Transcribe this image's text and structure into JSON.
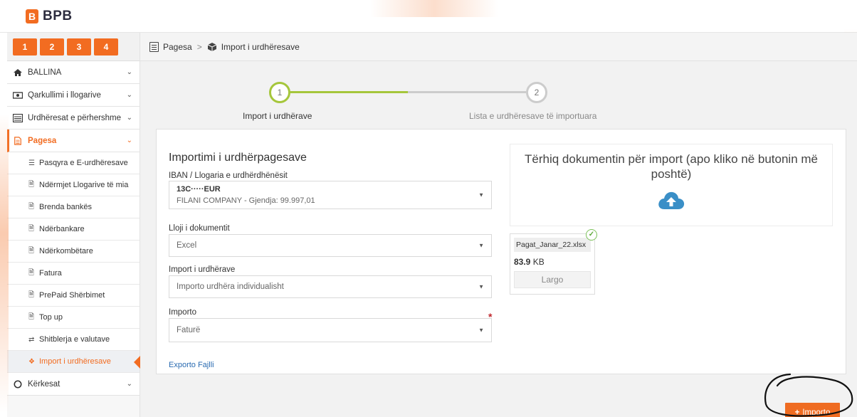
{
  "app": {
    "logo_text": "BPB",
    "logo_letter": "B"
  },
  "shortcuts": [
    "1",
    "2",
    "3",
    "4"
  ],
  "breadcrumb": {
    "parent": "Pagesa",
    "separator": ">",
    "current": "Import i urdhëresave"
  },
  "sidebar": {
    "items": [
      {
        "label": "BALLINA",
        "icon": "home-icon"
      },
      {
        "label": "Qarkullimi i llogarive",
        "icon": "money-icon"
      },
      {
        "label": "Urdhëresat e përhershme",
        "icon": "list-icon"
      },
      {
        "label": "Pagesa",
        "icon": "document-icon",
        "active": true
      },
      {
        "label": "Kërkesat",
        "icon": "circle-icon"
      }
    ],
    "sub_items": [
      {
        "label": "Pasqyra e E-urdhëresave",
        "icon": "list-icon"
      },
      {
        "label": "Ndërmjet Llogarive të mia",
        "icon": "file-icon"
      },
      {
        "label": "Brenda bankës",
        "icon": "file-icon"
      },
      {
        "label": "Ndërbankare",
        "icon": "file-icon"
      },
      {
        "label": "Ndërkombëtare",
        "icon": "file-icon"
      },
      {
        "label": "Fatura",
        "icon": "file-icon"
      },
      {
        "label": "PrePaid Shërbimet",
        "icon": "file-icon"
      },
      {
        "label": "Top up",
        "icon": "file-icon"
      },
      {
        "label": "Shitblerja e valutave",
        "icon": "exchange-icon"
      },
      {
        "label": "Import i urdhëresave",
        "icon": "cube-icon",
        "current": true
      }
    ]
  },
  "stepper": {
    "steps": [
      {
        "number": "1",
        "label": "Import i urdhërave",
        "state": "active"
      },
      {
        "number": "2",
        "label": "Lista e urdhëresave të importuara",
        "state": "pending"
      }
    ],
    "active_color": "#a5c63b",
    "pending_color": "#cccccc"
  },
  "form": {
    "title": "Importimi i urdhërpagesave",
    "iban_label": "IBAN / Llogaria e urdhërdhënësit",
    "iban_value": "13C·····EUR",
    "iban_sub": "FILANI COMPANY - Gjendja: 99.997,01",
    "doc_type_label": "Lloji i dokumentit",
    "doc_type_value": "Excel",
    "import_type_label": "Import i urdhërave",
    "import_type_value": "Importo urdhëra individualisht",
    "import_label": "Importo",
    "import_value": "Faturë",
    "required_mark": "*",
    "export_link": "Exporto Fajlli"
  },
  "upload": {
    "dropzone_text": "Tërhiq dokumentin për import (apo kliko në butonin më poshtë)",
    "file_name": "Pagat_Janar_22.xlsx",
    "file_size_value": "83.9",
    "file_size_unit": "KB",
    "remove_label": "Largo"
  },
  "actions": {
    "import_label": "Importo",
    "import_icon": "plus-icon"
  },
  "colors": {
    "accent": "#f26c21",
    "link": "#2a6bb1",
    "cloud": "#3a8fc7",
    "success": "#7cc15a"
  }
}
